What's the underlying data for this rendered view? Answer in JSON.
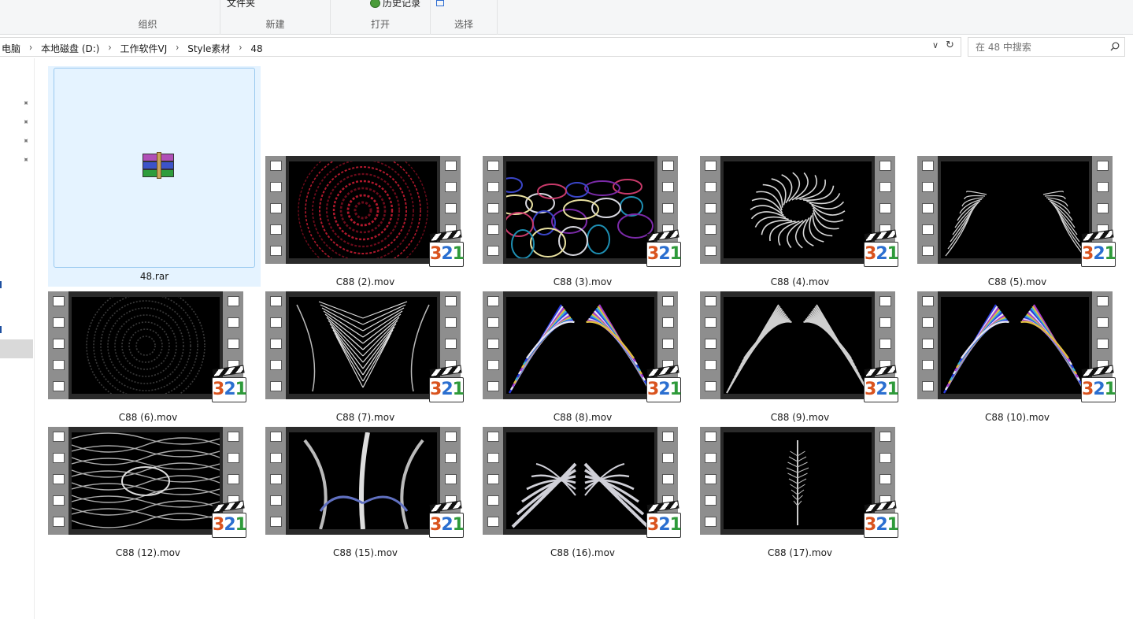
{
  "ribbon": {
    "groups": [
      {
        "label": "组织"
      },
      {
        "label": "新建",
        "item": "文件夹"
      },
      {
        "label": "打开",
        "item": "历史记录"
      },
      {
        "label": "选择"
      }
    ]
  },
  "address": {
    "crumbs": [
      "电脑",
      "本地磁盘 (D:)",
      "工作软件VJ",
      "Style素材",
      "48"
    ],
    "search_placeholder": "在 48 中搜索"
  },
  "icons": {
    "search": "search-icon",
    "refresh": "refresh-icon",
    "dropdown": "chevron-down-icon",
    "pin": "pin-icon",
    "archive": "winrar-archive-icon",
    "video_badge": "media-player-classic-321-icon"
  },
  "badge_text": {
    "d3": "3",
    "d2": "2",
    "d1": "1"
  },
  "files": [
    {
      "name": "48.rar",
      "kind": "archive",
      "selected": true
    },
    {
      "name": "C88 (2).mov",
      "kind": "video",
      "art": "red-tunnel"
    },
    {
      "name": "C88 (3).mov",
      "kind": "video",
      "art": "chrome-blobs"
    },
    {
      "name": "C88 (4).mov",
      "kind": "video",
      "art": "white-spiral"
    },
    {
      "name": "C88 (5).mov",
      "kind": "video",
      "art": "white-ferns"
    },
    {
      "name": "C88 (6).mov",
      "kind": "video",
      "art": "dark-tunnel"
    },
    {
      "name": "C88 (7).mov",
      "kind": "video",
      "art": "white-spikes"
    },
    {
      "name": "C88 (8).mov",
      "kind": "video",
      "art": "prism-wings"
    },
    {
      "name": "C88 (9).mov",
      "kind": "video",
      "art": "silver-wings"
    },
    {
      "name": "C88 (10).mov",
      "kind": "video",
      "art": "prism-wings"
    },
    {
      "name": "C88 (12).mov",
      "kind": "video",
      "art": "chrome-veins"
    },
    {
      "name": "C88 (15).mov",
      "kind": "video",
      "art": "chrome-horns"
    },
    {
      "name": "C88 (16).mov",
      "kind": "video",
      "art": "chrome-claws"
    },
    {
      "name": "C88 (17).mov",
      "kind": "video",
      "art": "spine"
    }
  ],
  "colors": {
    "selection_bg": "#e5f3ff",
    "selection_border": "#99c9ef",
    "ribbon_bg": "#f5f6f7"
  }
}
